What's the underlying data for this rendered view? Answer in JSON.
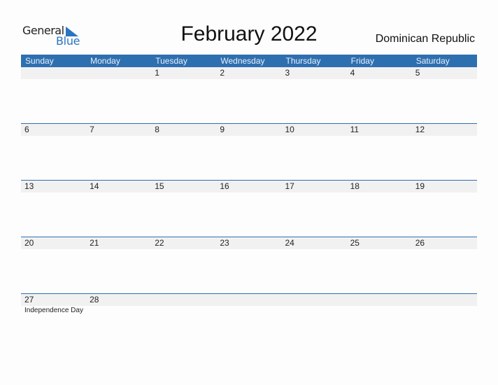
{
  "logo": {
    "general": "General",
    "blue": "Blue"
  },
  "title": "February 2022",
  "country": "Dominican Republic",
  "weekdays": [
    "Sunday",
    "Monday",
    "Tuesday",
    "Wednesday",
    "Thursday",
    "Friday",
    "Saturday"
  ],
  "weeks": [
    {
      "days": [
        "",
        "",
        "1",
        "2",
        "3",
        "4",
        "5"
      ],
      "notes": [
        "",
        "",
        "",
        "",
        "",
        "",
        ""
      ]
    },
    {
      "days": [
        "6",
        "7",
        "8",
        "9",
        "10",
        "11",
        "12"
      ],
      "notes": [
        "",
        "",
        "",
        "",
        "",
        "",
        ""
      ]
    },
    {
      "days": [
        "13",
        "14",
        "15",
        "16",
        "17",
        "18",
        "19"
      ],
      "notes": [
        "",
        "",
        "",
        "",
        "",
        "",
        ""
      ]
    },
    {
      "days": [
        "20",
        "21",
        "22",
        "23",
        "24",
        "25",
        "26"
      ],
      "notes": [
        "",
        "",
        "",
        "",
        "",
        "",
        ""
      ]
    },
    {
      "days": [
        "27",
        "28",
        "",
        "",
        "",
        "",
        ""
      ],
      "notes": [
        "Independence Day",
        "",
        "",
        "",
        "",
        "",
        ""
      ]
    }
  ],
  "colors": {
    "accent": "#2e6fb0",
    "band": "#f1f1f1"
  }
}
